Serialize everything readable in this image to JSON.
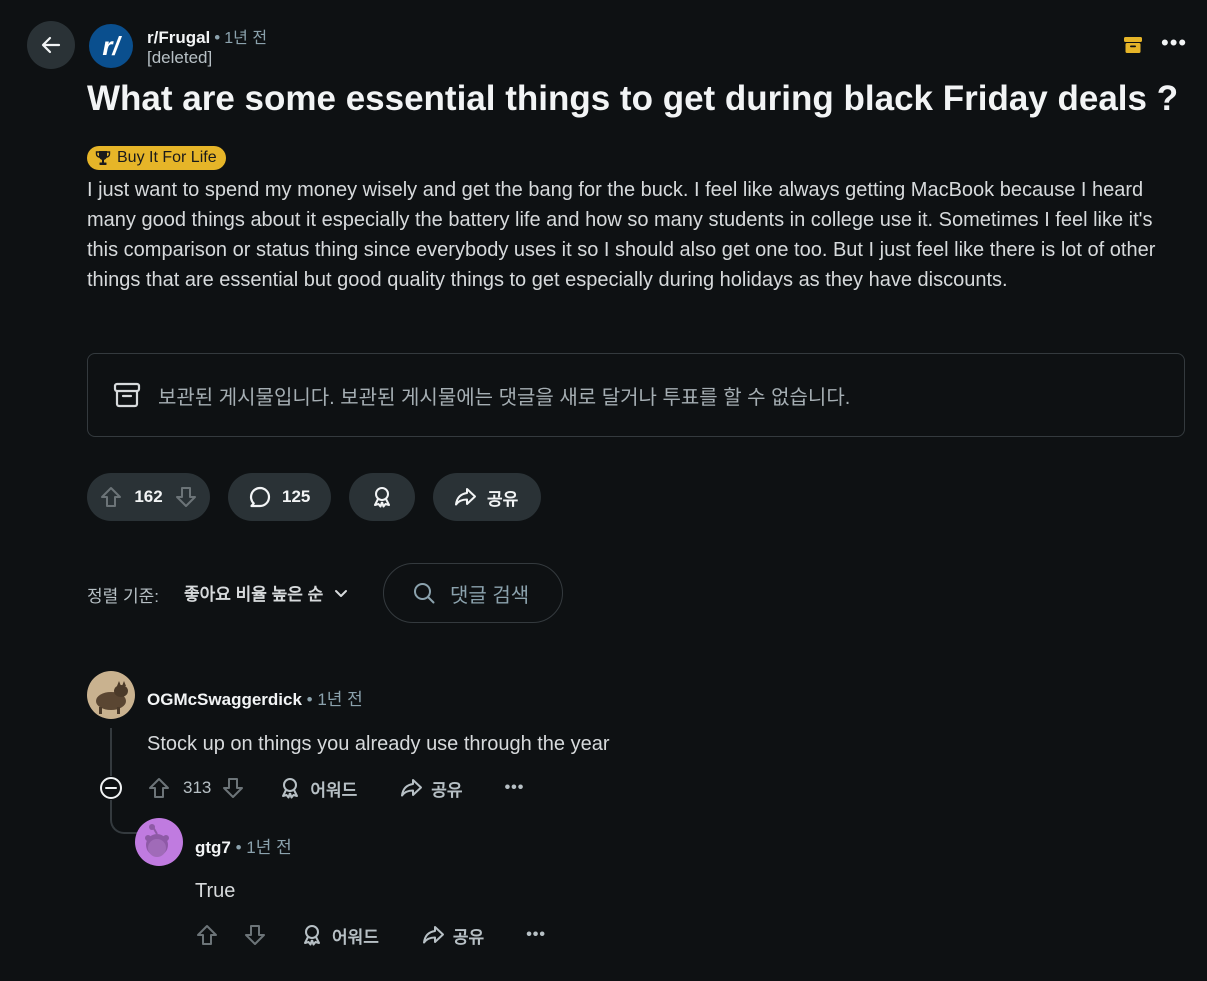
{
  "post": {
    "subreddit": "r/Frugal",
    "time": "1년 전",
    "author": "[deleted]",
    "title": "What are some essential things to get during black Friday deals ?",
    "flair": "Buy It For Life",
    "body": "I just want to spend my money wisely and get the bang for the buck. I feel like always getting MacBook because I heard many good things about it especially the battery life and how so many students in college use it. Sometimes I feel like it's this comparison or status thing since everybody uses it so I should also get one too. But I just feel like there is lot of other things that are essential but good quality things to get especially during holidays as they have discounts.",
    "archived_notice": "보관된 게시물입니다. 보관된 게시물에는 댓글을 새로 달거나 투표를 할 수 없습니다.",
    "votes": "162",
    "comments": "125",
    "share_label": "공유"
  },
  "sort": {
    "label": "정렬 기준:",
    "value": "좋아요 비율 높은 순"
  },
  "search": {
    "placeholder": "댓글 검색"
  },
  "comments": [
    {
      "author": "OGMcSwaggerdick",
      "time": "1년 전",
      "body": "Stock up on things you already use through the year",
      "votes": "313",
      "award_label": "어워드",
      "share_label": "공유"
    },
    {
      "author": "gtg7",
      "time": "1년 전",
      "body": "True",
      "votes": "",
      "award_label": "어워드",
      "share_label": "공유"
    }
  ],
  "colors": {
    "background": "#0e1113",
    "pill": "#2a3236",
    "flair": "#e6b528",
    "subreddit_avatar": "#0a4f8e",
    "archive_icon": "#e6b528"
  },
  "icons": {
    "back": "arrow-left-icon",
    "archive": "archive-box-icon",
    "more": "ellipsis-icon",
    "upvote": "arrow-up-icon",
    "downvote": "arrow-down-icon",
    "comment": "speech-bubble-icon",
    "award": "award-ribbon-icon",
    "share": "share-arrow-icon",
    "search": "magnifier-icon",
    "collapse": "minus-circle-icon",
    "chevron": "chevron-down-icon"
  }
}
